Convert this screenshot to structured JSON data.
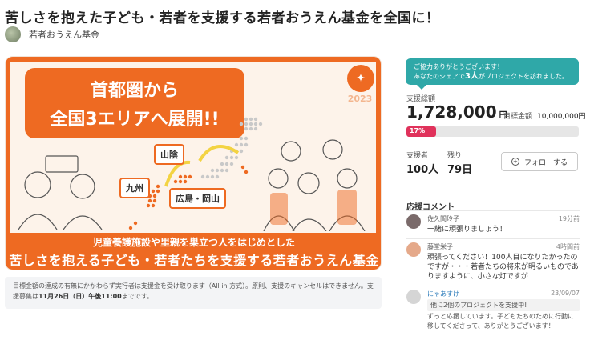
{
  "header": {
    "title": "苦しさを抱えた子ども・若者を支援する若者おうえん基金を全国に！",
    "owner_name": "若者おうえん基金"
  },
  "hero": {
    "headline_line1": "首都圏から",
    "headline_line2": "全国3エリアへ展開!!",
    "logo_text": "若者おうえん基金",
    "logo_year": "2023",
    "regions": [
      "山陰",
      "九州",
      "広島・岡山"
    ],
    "band_line1": "児童養護施設や里親を巣立つ人をはじめとした",
    "band_line2": "苦しさを抱える子ども・若者たちを支援する若者おうえん基金"
  },
  "notice": {
    "line1": "目標金額の達成の有無にかかわらず実行者は支援金を受け取ります（All in 方式）。原則、支援のキャンセルはできません。支",
    "line2_prefix": "援募集は",
    "deadline": "11月26日（日）午後11:00",
    "line2_suffix": "までです。"
  },
  "share_banner": {
    "line1": "ご協力ありがとうございます！",
    "line2_prefix": "あなたのシェアで",
    "count": "3人",
    "line2_suffix": "がプロジェクトを訪れました。"
  },
  "stats": {
    "total_label": "支援総額",
    "total_value": "1,728,000",
    "total_unit": "円",
    "goal_label": "目標金額",
    "goal_value": "10,000,000円",
    "progress_percent": 17,
    "progress_label": "17%",
    "supporters_label": "支援者",
    "supporters_value": "100人",
    "remaining_label": "残り",
    "remaining_value": "79日",
    "follow_label": "フォローする"
  },
  "comments": {
    "heading": "応援コメント",
    "items": [
      {
        "name": "佐久間玲子",
        "time": "19分前",
        "text": "一緒に頑張りましょう！"
      },
      {
        "name": "藤堂栄子",
        "time": "4時間前",
        "text": "頑張ってください！100人目になりたかったのですが・・・若者たちの将来が明るいものでありますように、小さな灯ですが"
      },
      {
        "name": "にゃあすけ",
        "time": "23/09/07",
        "support": "他に2個のプロジェクトを支援中!",
        "text": "ずっと応援しています。子どもたちのために行動に移してくださって、ありがとうございます！"
      }
    ]
  },
  "colors": {
    "brand_orange": "#ee6a22",
    "teal": "#2fa8a8",
    "progress": "#e0325b"
  }
}
